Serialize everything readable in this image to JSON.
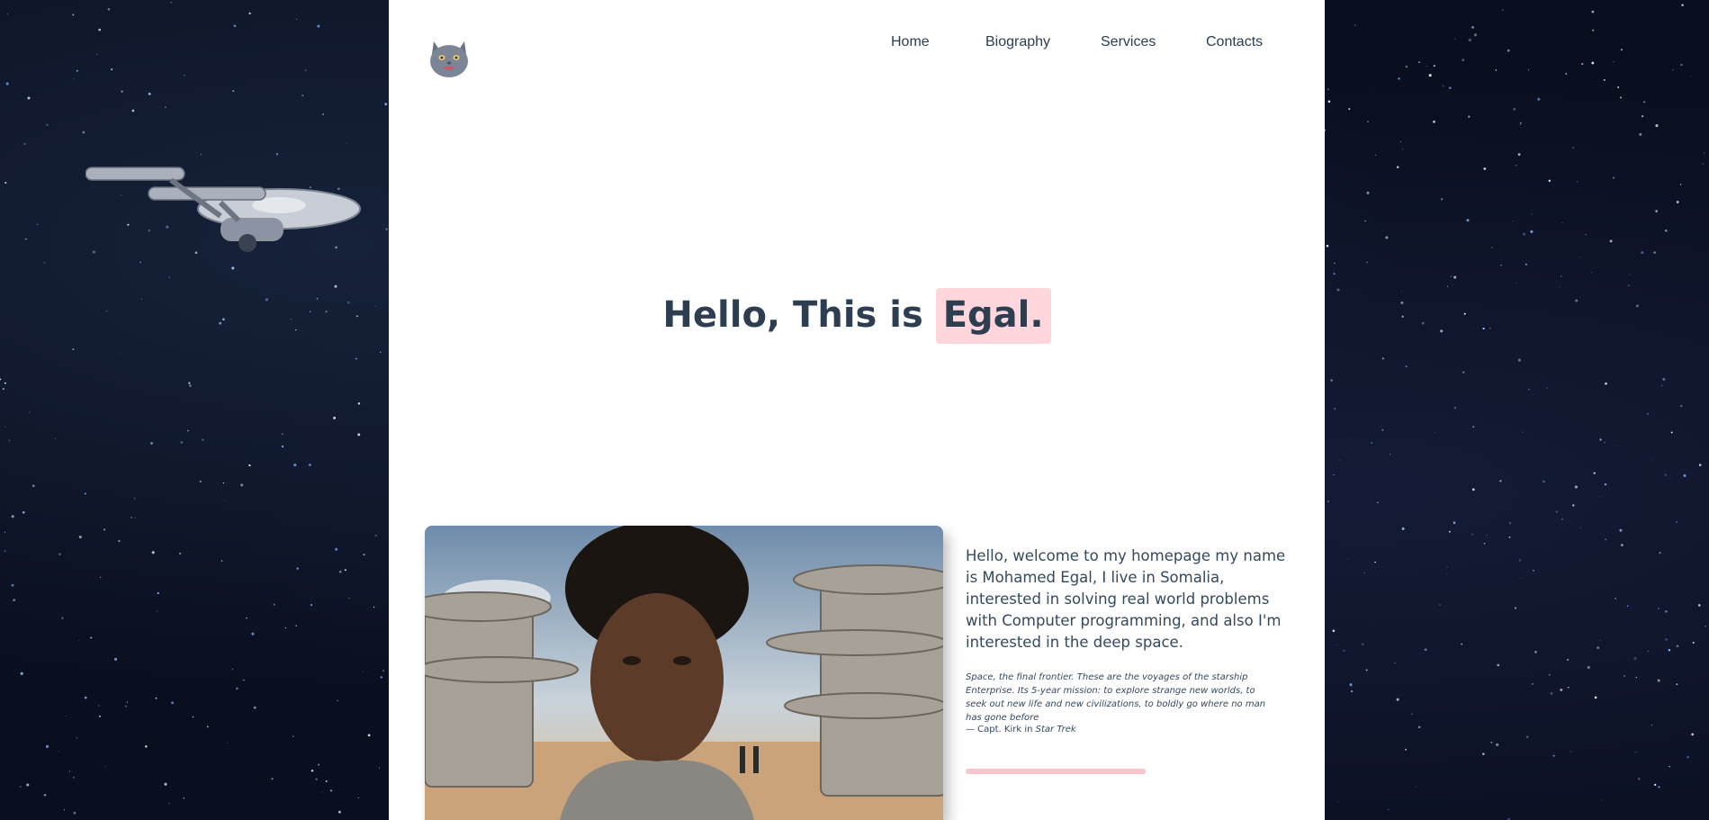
{
  "nav": {
    "items": [
      {
        "label": "Home"
      },
      {
        "label": "Biography"
      },
      {
        "label": "Services"
      },
      {
        "label": "Contacts"
      }
    ]
  },
  "hero": {
    "prefix": "Hello, This is",
    "highlight": "Egal."
  },
  "about": {
    "intro": "Hello, welcome to my homepage my name is Mohamed Egal, I live in Somalia, interested in solving real world problems with Computer programming, and also I'm interested in the deep space.",
    "quote": "Space, the final frontier. These are the voyages of the starship Enterprise. Its 5-year mission: to explore strange new worlds, to seek out new life and new civilizations, to boldly go where no man has gone before",
    "cite_prefix": "— Capt. Kirk in",
    "cite_source": "Star Trek",
    "progress": 1.0
  },
  "icons": {
    "logo": "cat-avatar-icon",
    "ship": "starship-icon"
  },
  "colors": {
    "accent": "#ffd6dc",
    "text": "#2c3e50",
    "background": "#0a0f1f"
  }
}
